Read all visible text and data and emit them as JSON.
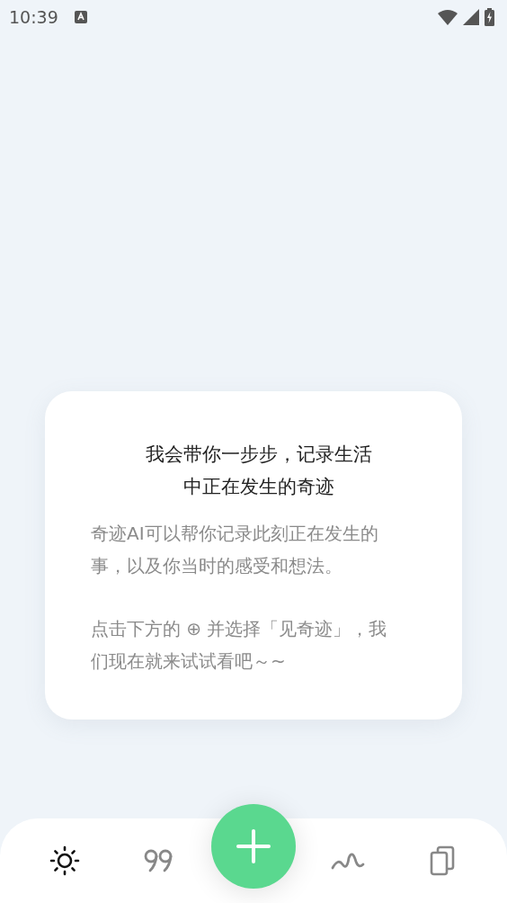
{
  "status_bar": {
    "time": "10:39"
  },
  "card": {
    "title": "我会带你一步步，记录生活中正在发生的奇迹",
    "paragraphs": [
      "奇迹AI可以帮你记录此刻正在发生的事，以及你当时的感受和想法。",
      "点击下方的 ⊕ 并选择「见奇迹」，我们现在就来试试看吧～~"
    ]
  },
  "nav": {
    "tabs": [
      {
        "kind": "sun",
        "selected": true
      },
      {
        "kind": "quote",
        "selected": false
      },
      {
        "kind": "wave",
        "selected": false
      },
      {
        "kind": "cards",
        "selected": false
      }
    ]
  }
}
